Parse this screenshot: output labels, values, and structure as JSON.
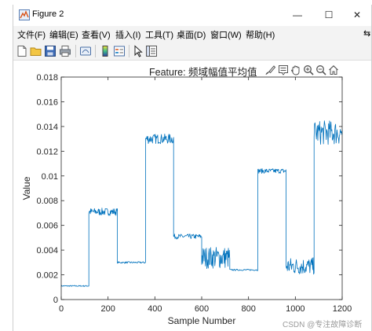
{
  "window": {
    "title": "Figure 2",
    "minimize_glyph": "—",
    "maximize_glyph": "☐",
    "close_glyph": "✕"
  },
  "menu": {
    "items": [
      "文件(F)",
      "编辑(E)",
      "查看(V)",
      "插入(I)",
      "工具(T)",
      "桌面(D)",
      "窗口(W)",
      "帮助(H)"
    ],
    "overflow": "⇆"
  },
  "toolbar": {
    "icons": [
      "new-figure-icon",
      "open-file-icon",
      "save-icon",
      "print-icon",
      "link-plot-icon",
      "colorbar-icon",
      "legend-icon",
      "pointer-icon",
      "property-inspector-icon"
    ]
  },
  "axes_toolbar": {
    "title_text": "Feature: 频域幅值平均值",
    "icons": [
      "brush-icon",
      "data-tips-icon",
      "pan-hand-icon",
      "zoom-in-icon",
      "zoom-out-icon",
      "home-icon"
    ]
  },
  "watermark": "CSDN @专注故障诊断",
  "chart_data": {
    "type": "line",
    "title": "",
    "xlabel": "Sample Number",
    "ylabel": "Value",
    "xlim": [
      0,
      1200
    ],
    "ylim": [
      0,
      0.018
    ],
    "xticks": [
      "0",
      "200",
      "400",
      "600",
      "800",
      "1000",
      "1200"
    ],
    "yticks": [
      "0",
      "0.002",
      "0.004",
      "0.006",
      "0.008",
      "0.01",
      "0.012",
      "0.014",
      "0.016",
      "0.018"
    ],
    "grid": false,
    "line_color": "#0072bd",
    "series": [
      {
        "name": "",
        "segments": [
          {
            "x_start": 0,
            "x_end": 118,
            "level": 0.0011,
            "noise": 5e-05
          },
          {
            "x_start": 118,
            "x_end": 240,
            "level": 0.0071,
            "noise": 0.0003
          },
          {
            "x_start": 240,
            "x_end": 360,
            "level": 0.003,
            "noise": 7e-05
          },
          {
            "x_start": 360,
            "x_end": 480,
            "level": 0.013,
            "noise": 0.0004
          },
          {
            "x_start": 480,
            "x_end": 600,
            "level": 0.0051,
            "noise": 0.0002
          },
          {
            "x_start": 600,
            "x_end": 720,
            "level": 0.0034,
            "noise": 0.0009
          },
          {
            "x_start": 720,
            "x_end": 840,
            "level": 0.0024,
            "noise": 6e-05
          },
          {
            "x_start": 840,
            "x_end": 960,
            "level": 0.0104,
            "noise": 0.0002
          },
          {
            "x_start": 960,
            "x_end": 1080,
            "level": 0.0027,
            "noise": 0.0007
          },
          {
            "x_start": 1080,
            "x_end": 1200,
            "level": 0.0135,
            "noise": 0.001
          }
        ]
      }
    ]
  }
}
